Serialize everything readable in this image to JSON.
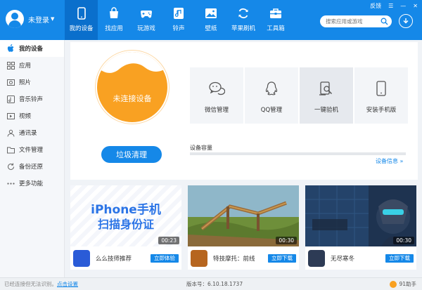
{
  "user": {
    "name": "未登录"
  },
  "nav": [
    {
      "label": "我的设备",
      "icon": "phone-icon"
    },
    {
      "label": "找应用",
      "icon": "bag-icon"
    },
    {
      "label": "玩游戏",
      "icon": "gamepad-icon"
    },
    {
      "label": "铃声",
      "icon": "music-icon"
    },
    {
      "label": "壁纸",
      "icon": "picture-icon"
    },
    {
      "label": "苹果刷机",
      "icon": "refresh-icon"
    },
    {
      "label": "工具箱",
      "icon": "toolbox-icon"
    }
  ],
  "window": {
    "feedback": "反馈"
  },
  "search": {
    "placeholder": "搜索应用或游戏"
  },
  "sidebar": [
    {
      "label": "我的设备"
    },
    {
      "label": "应用"
    },
    {
      "label": "照片"
    },
    {
      "label": "音乐铃声"
    },
    {
      "label": "视频"
    },
    {
      "label": "通讯录"
    },
    {
      "label": "文件管理"
    },
    {
      "label": "备份还原"
    },
    {
      "label": "更多功能"
    }
  ],
  "device": {
    "status": "未连接设备",
    "clean_button": "垃圾清理",
    "capacity_label": "设备容量",
    "info_link": "设备信息 »"
  },
  "tools": [
    {
      "label": "微信管理",
      "icon": "wechat-icon"
    },
    {
      "label": "QQ管理",
      "icon": "qq-icon"
    },
    {
      "label": "一键验机",
      "icon": "inspect-icon"
    },
    {
      "label": "安装手机版",
      "icon": "phone-install-icon"
    }
  ],
  "cards": [
    {
      "title": "么么技师推荐",
      "button": "立即体验",
      "duration": "00:23",
      "banner_line1": "iPhone手机",
      "banner_line2": "扫描身份证"
    },
    {
      "title": "特技摩托：前线",
      "button": "立即下载",
      "duration": "00:30"
    },
    {
      "title": "无尽寒冬",
      "button": "立即下载",
      "duration": "00:30"
    }
  ],
  "statusbar": {
    "left_text": "已经连接但无法识别。",
    "left_link": "点击设置",
    "version": "版本号：6.10.18.1737",
    "brand": "91助手"
  },
  "colors": {
    "accent": "#1588e8",
    "orange": "#f9a122"
  }
}
